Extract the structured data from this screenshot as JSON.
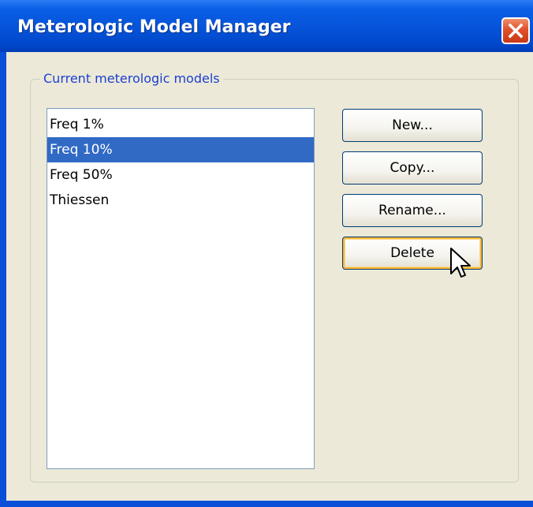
{
  "window": {
    "title": "Meterologic Model Manager",
    "accent_color": "#0054e3",
    "close_icon": "close-icon"
  },
  "group": {
    "label": "Current meterologic models"
  },
  "models": [
    {
      "label": "Freq 1%",
      "selected": false
    },
    {
      "label": "Freq 10%",
      "selected": true
    },
    {
      "label": "Freq 50%",
      "selected": false
    },
    {
      "label": "Thiessen",
      "selected": false
    }
  ],
  "buttons": {
    "new_label": "New...",
    "copy_label": "Copy...",
    "rename_label": "Rename...",
    "delete_label": "Delete"
  },
  "colors": {
    "selection": "#316ac5",
    "dialog_bg": "#ece9d8",
    "group_label": "#1c3fd1"
  }
}
